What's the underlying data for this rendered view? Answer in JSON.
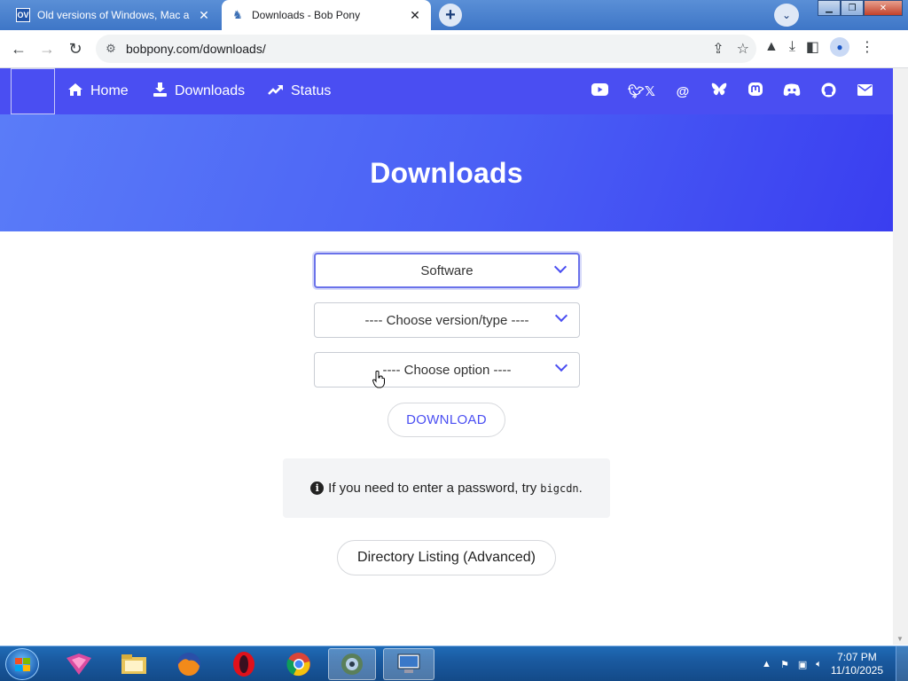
{
  "browser": {
    "tabs": [
      {
        "title": "Old versions of Windows, Mac a",
        "favicon": "OV",
        "state": "inactive"
      },
      {
        "title": "Downloads - Bob Pony",
        "favicon": "pony-icon",
        "state": "active"
      }
    ],
    "new_tab": "+",
    "url": "bobpony.com/downloads/"
  },
  "site": {
    "nav": {
      "home": "Home",
      "downloads": "Downloads",
      "status": "Status"
    },
    "socials": [
      "youtube-icon",
      "x-icon",
      "threads-icon",
      "bluesky-icon",
      "mastodon-icon",
      "discord-icon",
      "github-icon",
      "email-icon"
    ],
    "hero_title": "Downloads",
    "selects": {
      "software": "Software",
      "version": "---- Choose version/type ----",
      "option": "---- Choose option ----"
    },
    "download_button": "DOWNLOAD",
    "info": {
      "text": "If you need to enter a password, try",
      "password": "bigcdn",
      "suffix": "."
    },
    "directory_button": "Directory Listing (Advanced)"
  },
  "taskbar": {
    "time": "7:07 PM",
    "date": "11/10/2025"
  },
  "colors": {
    "nav_bg": "#4a4ef2",
    "hero_start": "#5a7cf8",
    "hero_end": "#3a3ef0",
    "accent": "#4a4ef2"
  }
}
